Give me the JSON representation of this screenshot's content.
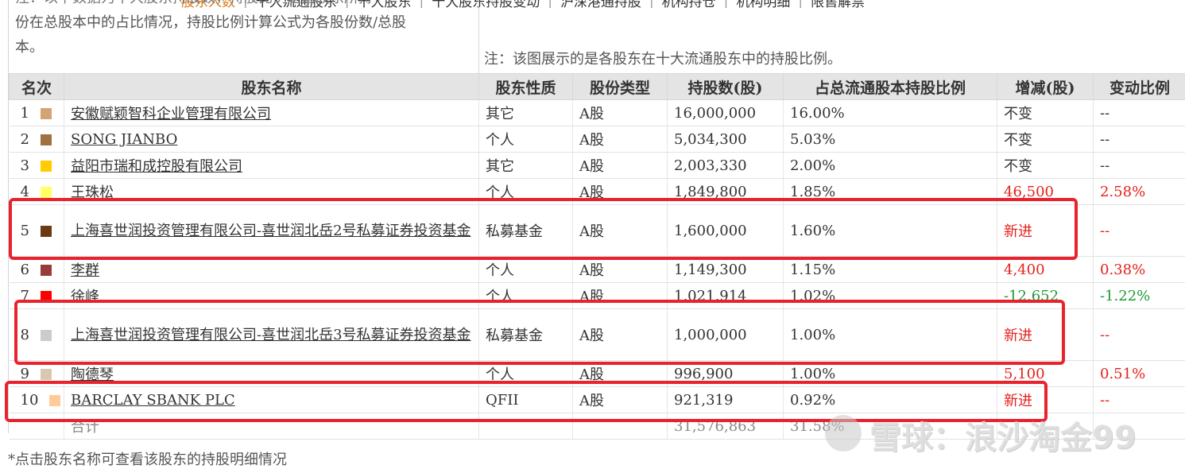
{
  "nav": {
    "tabs": [
      "股东人数",
      "十大流通股东",
      "十大股东",
      "十大股东持股变动",
      "沪深港通持股",
      "机构持仓",
      "机构明细",
      "限售解禁"
    ],
    "active_index": 0
  },
  "description": {
    "line0": "注：以下数据为十大股东持股数，持股比例是指股东所持",
    "line1": "份在总股本中的占比情况，持股比例计算公式为各股份数/总股",
    "line2": "本。"
  },
  "chart_note": "注：该图展示的是各股东在十大流通股东中的持股比例。",
  "table": {
    "headers": [
      "名次",
      "股东名称",
      "股东性质",
      "股份类型",
      "持股数(股)",
      "占总流通股本持股比例",
      "增减(股)",
      "变动比例"
    ],
    "rows": [
      {
        "rank": "1",
        "color": "#d4a373",
        "name": "安徽赋颖智科企业管理有限公司",
        "nature": "其它",
        "type": "A股",
        "shares": "16,000,000",
        "ratio": "16.00%",
        "change": "不变",
        "change_pct": "--",
        "trend": "none"
      },
      {
        "rank": "2",
        "color": "#a07040",
        "name": "SONG JIANBO",
        "nature": "个人",
        "type": "A股",
        "shares": "5,034,300",
        "ratio": "5.03%",
        "change": "不变",
        "change_pct": "--",
        "trend": "none"
      },
      {
        "rank": "3",
        "color": "#ffcc00",
        "name": "益阳市瑞和成控股有限公司",
        "nature": "其它",
        "type": "A股",
        "shares": "2,003,330",
        "ratio": "2.00%",
        "change": "不变",
        "change_pct": "--",
        "trend": "none"
      },
      {
        "rank": "4",
        "color": "#ffff66",
        "name": "王珠松",
        "nature": "个人",
        "type": "A股",
        "shares": "1,849,800",
        "ratio": "1.85%",
        "change": "46,500",
        "change_pct": "2.58%",
        "trend": "up"
      },
      {
        "rank": "5",
        "color": "#6b3a10",
        "name": "上海喜世润投资管理有限公司-喜世润北岳2号私募证券投资基金",
        "nature": "私募基金",
        "type": "A股",
        "shares": "1,600,000",
        "ratio": "1.60%",
        "change": "新进",
        "change_pct": "--",
        "trend": "up",
        "tall": true
      },
      {
        "rank": "6",
        "color": "#9a3b3b",
        "name": "李群",
        "nature": "个人",
        "type": "A股",
        "shares": "1,149,300",
        "ratio": "1.15%",
        "change": "4,400",
        "change_pct": "0.38%",
        "trend": "up"
      },
      {
        "rank": "7",
        "color": "#ff0000",
        "name": "徐峰",
        "nature": "个人",
        "type": "A股",
        "shares": "1,021,914",
        "ratio": "1.02%",
        "change": "-12,652",
        "change_pct": "-1.22%",
        "trend": "down"
      },
      {
        "rank": "8",
        "color": "#cccccc",
        "name": "上海喜世润投资管理有限公司-喜世润北岳3号私募证券投资基金",
        "nature": "私募基金",
        "type": "A股",
        "shares": "1,000,000",
        "ratio": "1.00%",
        "change": "新进",
        "change_pct": "--",
        "trend": "up",
        "tall": true
      },
      {
        "rank": "9",
        "color": "#d9c8b0",
        "name": "陶德琴",
        "nature": "个人",
        "type": "A股",
        "shares": "996,900",
        "ratio": "1.00%",
        "change": "5,100",
        "change_pct": "0.51%",
        "trend": "up"
      },
      {
        "rank": "10",
        "color": "#ffcc99",
        "name": "BARCLAY SBANK PLC",
        "nature": "QFII",
        "type": "A股",
        "shares": "921,319",
        "ratio": "0.92%",
        "change": "新进",
        "change_pct": "--",
        "trend": "up"
      }
    ],
    "total": {
      "label": "合计",
      "shares": "31,576,863",
      "ratio": "31.58%"
    }
  },
  "footnote": "*点击股东名称可查看该股东的持股明细情况",
  "watermark": "雪球：浪沙淘金99",
  "colors": {
    "up": "#e3211c",
    "down": "#1a9a33",
    "highlight": "#e8232e",
    "active_tab": "#e07a16"
  }
}
